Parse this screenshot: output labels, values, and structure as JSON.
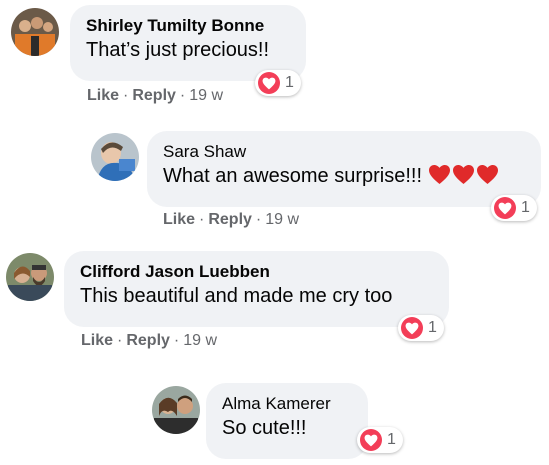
{
  "comments": [
    {
      "author": "Shirley Tumilty Bonne",
      "text": "That’s just precious!!",
      "reaction": {
        "icon": "love-reaction-icon",
        "count": "1"
      },
      "like_label": "Like",
      "reply_label": "Reply",
      "separator": "·",
      "time": "19 w"
    },
    {
      "author": "Sara Shaw",
      "text": "What an awesome surprise!!!",
      "emoji": [
        "red-heart-emoji",
        "red-heart-emoji",
        "red-heart-emoji"
      ],
      "reaction": {
        "icon": "love-reaction-icon",
        "count": "1"
      },
      "like_label": "Like",
      "reply_label": "Reply",
      "separator": "·",
      "time": "19 w"
    },
    {
      "author": "Clifford Jason Luebben",
      "text": "This beautiful and made me cry too",
      "reaction": {
        "icon": "love-reaction-icon",
        "count": "1"
      },
      "like_label": "Like",
      "reply_label": "Reply",
      "separator": "·",
      "time": "19 w"
    },
    {
      "author": "Alma Kamerer",
      "text": "So cute!!!",
      "reaction": {
        "icon": "love-reaction-icon",
        "count": "1"
      }
    }
  ],
  "colors": {
    "bubble": "#f0f2f5",
    "meta_text": "#65676b",
    "love_reaction": "#f33e58",
    "heart_emoji": "#e02a2a"
  }
}
